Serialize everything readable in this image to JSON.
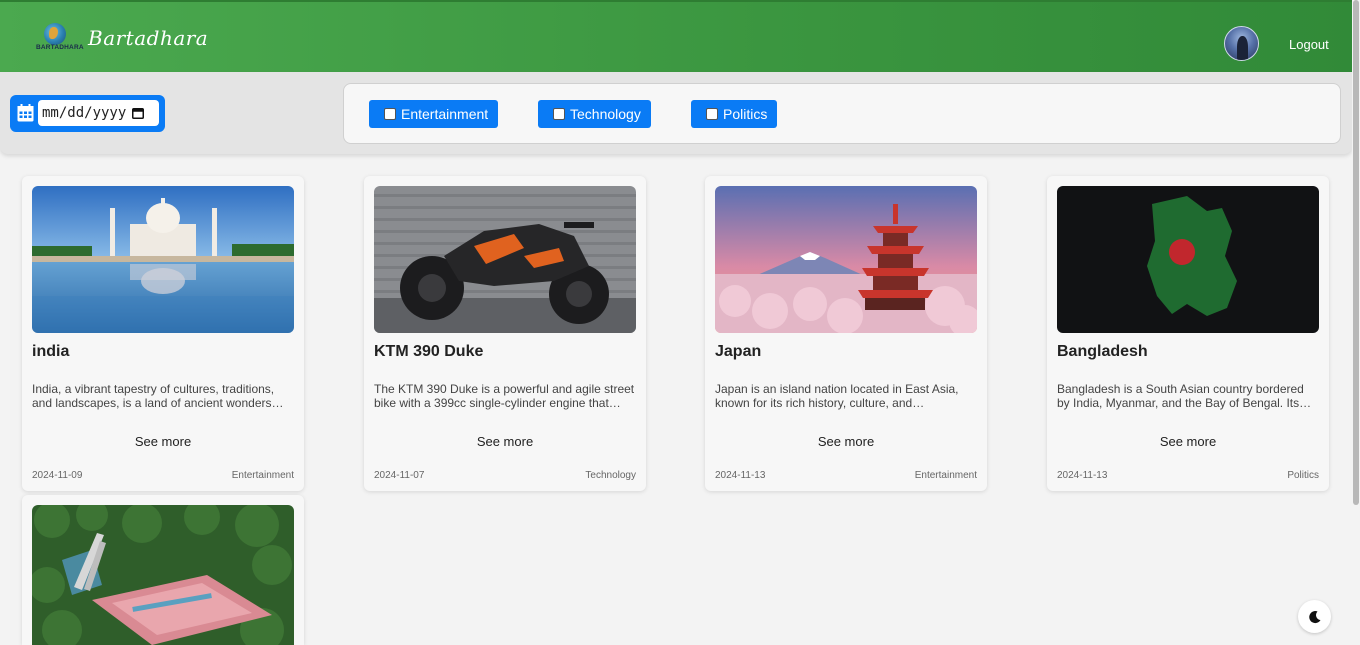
{
  "header": {
    "logo_text": "BARTADHARA",
    "brand": "Bartadhara",
    "logout_label": "Logout",
    "colors": {
      "bar_start": "#4ba94f",
      "bar_end": "#318a38"
    }
  },
  "filters": {
    "date_placeholder": "mm/dd/yyyy",
    "categories": [
      {
        "label": "Entertainment",
        "checked": false
      },
      {
        "label": "Technology",
        "checked": false
      },
      {
        "label": "Politics",
        "checked": false
      }
    ],
    "accent": "#0a7bf5"
  },
  "cards": [
    {
      "title": "india",
      "description": "India, a vibrant tapestry of cultures, traditions, and landscapes, is a land of ancient wonders…",
      "see_more": "See more",
      "date": "2024-11-09",
      "category": "Entertainment"
    },
    {
      "title": "KTM 390 Duke",
      "description": "The KTM 390 Duke is a powerful and agile street bike with a 399cc single-cylinder engine that…",
      "see_more": "See more",
      "date": "2024-11-07",
      "category": "Technology"
    },
    {
      "title": "Japan",
      "description": "Japan is an island nation located in East Asia, known for its rich history, culture, and…",
      "see_more": "See more",
      "date": "2024-11-13",
      "category": "Entertainment"
    },
    {
      "title": "Bangladesh",
      "description": "Bangladesh is a South Asian country bordered by India, Myanmar, and the Bay of Bengal. Its…",
      "see_more": "See more",
      "date": "2024-11-13",
      "category": "Politics"
    },
    {
      "title": "",
      "description": "",
      "see_more": "",
      "date": "",
      "category": ""
    }
  ],
  "icons": {
    "calendar": "calendar-icon",
    "theme_toggle": "moon-icon"
  }
}
